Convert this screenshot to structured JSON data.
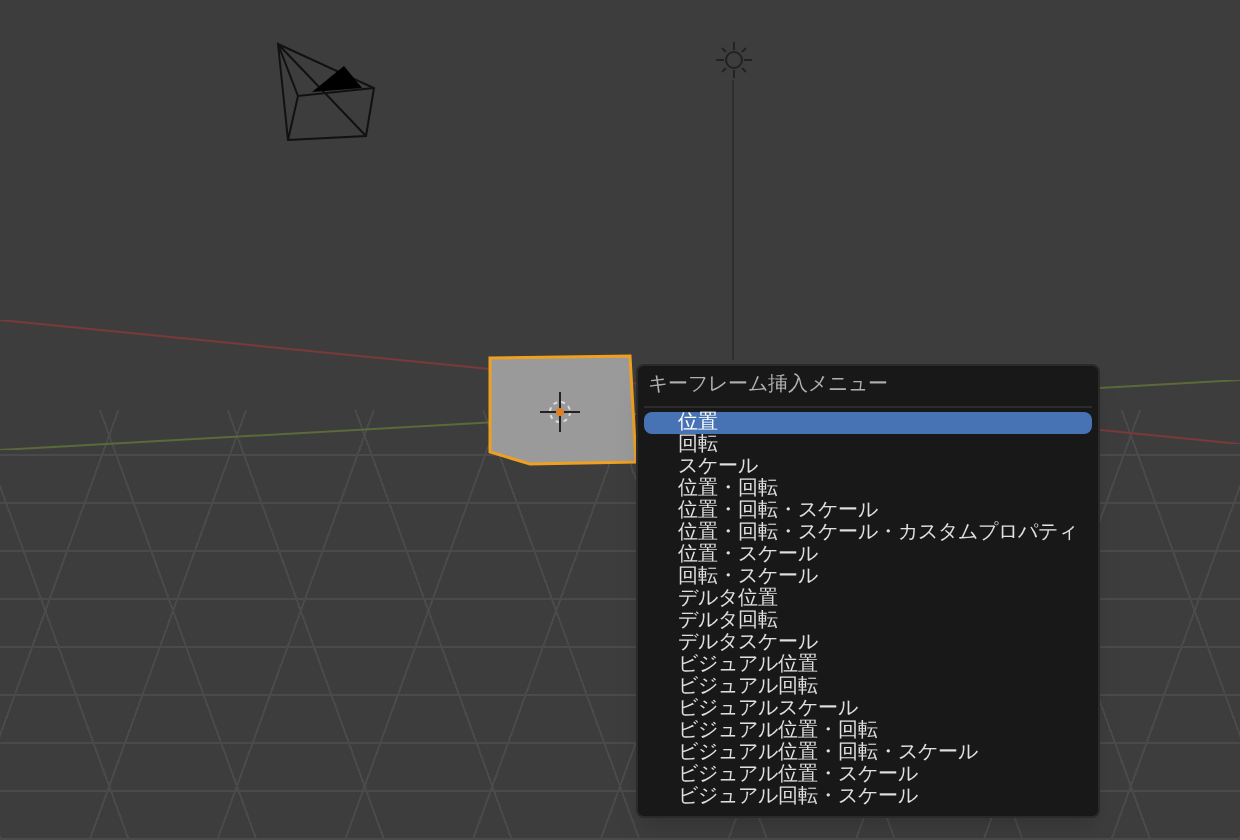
{
  "menu": {
    "title": "キーフレーム挿入メニュー",
    "items": [
      {
        "label": "位置",
        "selected": true
      },
      {
        "label": "回転",
        "selected": false
      },
      {
        "label": "スケール",
        "selected": false
      },
      {
        "label": "位置・回転",
        "selected": false
      },
      {
        "label": "位置・回転・スケール",
        "selected": false
      },
      {
        "label": "位置・回転・スケール・カスタムプロパティ",
        "selected": false
      },
      {
        "label": "位置・スケール",
        "selected": false
      },
      {
        "label": "回転・スケール",
        "selected": false
      },
      {
        "label": "デルタ位置",
        "selected": false
      },
      {
        "label": "デルタ回転",
        "selected": false
      },
      {
        "label": "デルタスケール",
        "selected": false
      },
      {
        "label": "ビジュアル位置",
        "selected": false
      },
      {
        "label": "ビジュアル回転",
        "selected": false
      },
      {
        "label": "ビジュアルスケール",
        "selected": false
      },
      {
        "label": "ビジュアル位置・回転",
        "selected": false
      },
      {
        "label": "ビジュアル位置・回転・スケール",
        "selected": false
      },
      {
        "label": "ビジュアル位置・スケール",
        "selected": false
      },
      {
        "label": "ビジュアル回転・スケール",
        "selected": false
      }
    ]
  }
}
